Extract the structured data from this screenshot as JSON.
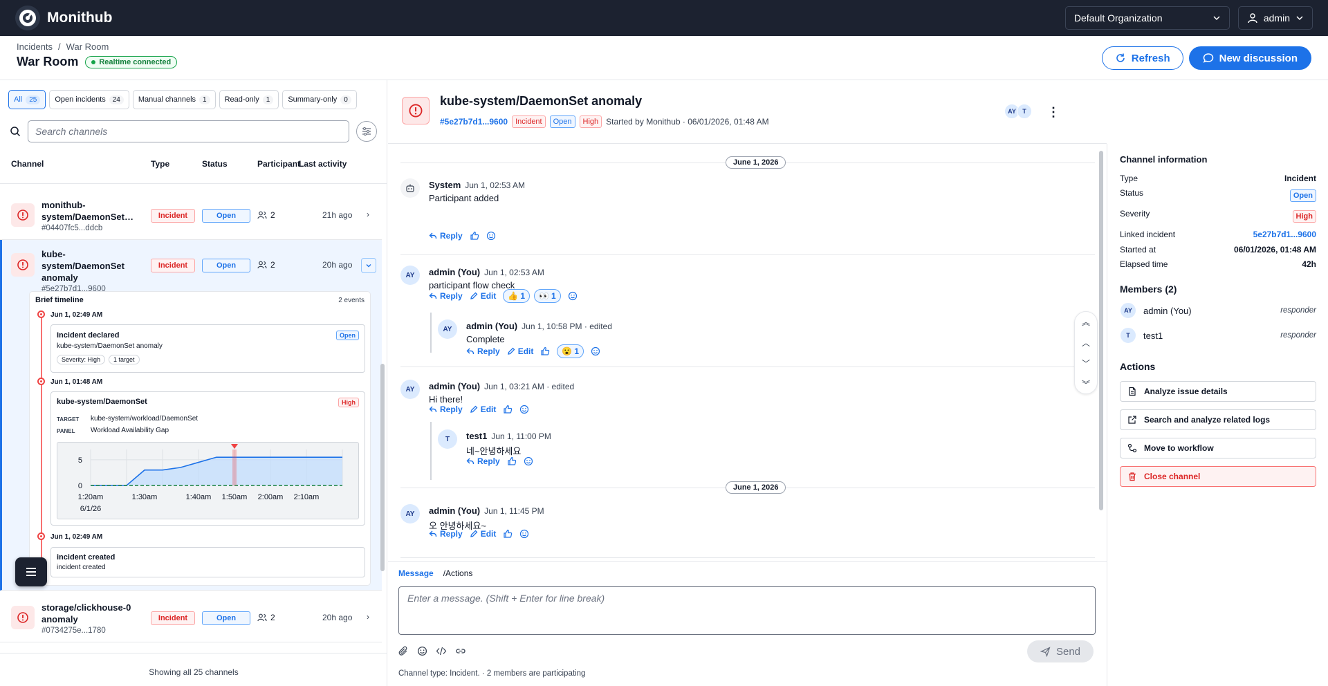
{
  "app": {
    "name": "Monithub"
  },
  "topbar": {
    "organization": "Default Organization",
    "user": "admin"
  },
  "breadcrumb": [
    "Incidents",
    "/",
    "War Room"
  ],
  "page": {
    "title": "War Room",
    "realtime": "Realtime connected",
    "refresh": "Refresh",
    "new_discussion": "New discussion"
  },
  "filters": [
    {
      "label": "All",
      "count": "25"
    },
    {
      "label": "Open incidents",
      "count": "24"
    },
    {
      "label": "Manual channels",
      "count": "1"
    },
    {
      "label": "Read-only",
      "count": "1"
    },
    {
      "label": "Summary-only",
      "count": "0"
    }
  ],
  "search": {
    "placeholder": "Search channels"
  },
  "columns": {
    "channel": "Channel",
    "type": "Type",
    "status": "Status",
    "participants": "Participants",
    "last_activity": "Last activity"
  },
  "channels": [
    {
      "name": "monithub-system/DaemonSet…",
      "id": "#04407fc5...ddcb",
      "type": "Incident",
      "status": "Open",
      "participants": "2",
      "last": "21h ago"
    },
    {
      "name": "kube-system/DaemonSet anomaly",
      "id": "#5e27b7d1...9600",
      "type": "Incident",
      "status": "Open",
      "participants": "2",
      "last": "20h ago"
    },
    {
      "name": "storage/clickhouse-0 anomaly",
      "id": "#0734275e...1780",
      "type": "Incident",
      "status": "Open",
      "participants": "2",
      "last": "20h ago"
    }
  ],
  "timeline": {
    "title": "Brief timeline",
    "events_count": "2 events",
    "events": [
      {
        "time": "Jun 1, 02:49 AM",
        "title": "Incident declared",
        "desc": "kube-system/DaemonSet anomaly",
        "badge": "Open",
        "tags": [
          "Severity: High",
          "1 target"
        ]
      },
      {
        "time": "Jun 1, 01:48 AM",
        "title": "kube-system/DaemonSet",
        "badge": "High",
        "target_label": "TARGET",
        "target": "kube-system/workload/DaemonSet",
        "panel_label": "PANEL",
        "panel": "Workload Availability Gap"
      },
      {
        "time": "Jun 1, 02:49 AM",
        "title": "incident created",
        "desc": "incident created"
      }
    ]
  },
  "chart_data": {
    "type": "area",
    "x": [
      "1:20am",
      "1:25am",
      "1:28am",
      "1:30am",
      "1:32am",
      "1:35am",
      "1:40am",
      "1:45am",
      "1:50am",
      "1:55am",
      "2:00am",
      "2:05am",
      "2:10am",
      "2:15am",
      "2:20am"
    ],
    "series": [
      {
        "values": [
          0,
          0,
          0,
          3,
          3,
          3.5,
          4.5,
          5.5,
          5.5,
          5.5,
          5.5,
          5.5,
          5.5,
          5.5,
          5.5
        ]
      }
    ],
    "baseline": 0,
    "xticks": [
      "1:20am",
      "1:30am",
      "1:40am",
      "1:50am",
      "2:00am",
      "2:10am"
    ],
    "date_label": "6/1/26",
    "yticks": [
      "0",
      "5"
    ],
    "ylim": [
      0,
      7
    ],
    "marker_x": "1:50am",
    "colors": {
      "line": "#1d72e8",
      "fill": "#bfdbfe",
      "baseline": "#15803d",
      "marker": "#ef4444"
    }
  },
  "left_footer": {
    "showing": "Showing all 25 channels"
  },
  "channel": {
    "title": "kube-system/DaemonSet anomaly",
    "id": "#5e27b7d1...9600",
    "type": "Incident",
    "status": "Open",
    "severity": "High",
    "started_by": "Started by Monithub · 06/01/2026, 01:48 AM",
    "avatars": [
      "AY",
      "T"
    ]
  },
  "messages": {
    "date1": "June 1, 2026",
    "date2": "June 1, 2026",
    "reply": "Reply",
    "edit": "Edit",
    "m1": {
      "author": "System",
      "time": "Jun 1, 02:53 AM",
      "text": "Participant added"
    },
    "m2": {
      "avatar": "AY",
      "author": "admin (You)",
      "time": "Jun 1, 02:53 AM",
      "text": "participant flow check",
      "reactions": [
        {
          "emoji": "👍",
          "count": "1"
        },
        {
          "emoji": "👀",
          "count": "1"
        }
      ]
    },
    "m2r": {
      "avatar": "AY",
      "author": "admin (You)",
      "time": "Jun 1, 10:58 PM · edited",
      "text": "Complete",
      "reactions": [
        {
          "emoji": "😮",
          "count": "1"
        }
      ]
    },
    "m3": {
      "avatar": "AY",
      "author": "admin (You)",
      "time": "Jun 1, 03:21 AM · edited",
      "text": "Hi there!"
    },
    "m3r": {
      "avatar": "T",
      "author": "test1",
      "time": "Jun 1, 11:00 PM",
      "text": "네~안녕하세요"
    },
    "m4": {
      "avatar": "AY",
      "author": "admin (You)",
      "time": "Jun 1, 11:45 PM",
      "text": "오 안녕하세요~"
    }
  },
  "composer": {
    "tab_message": "Message",
    "tab_actions": "/Actions",
    "placeholder": "Enter a message. (Shift + Enter for line break)",
    "send": "Send",
    "hint": "Channel type: Incident. · 2 members are participating"
  },
  "info": {
    "title": "Channel information",
    "rows": [
      {
        "label": "Type",
        "value": "Incident"
      },
      {
        "label": "Status",
        "value": "Open"
      },
      {
        "label": "Severity",
        "value": "High"
      },
      {
        "label": "Linked incident",
        "value": "5e27b7d1...9600"
      },
      {
        "label": "Started at",
        "value": "06/01/2026, 01:48 AM"
      },
      {
        "label": "Elapsed time",
        "value": "42h"
      }
    ],
    "members_title": "Members (2)",
    "members": [
      {
        "avatar": "AY",
        "name": "admin (You)",
        "role": "responder"
      },
      {
        "avatar": "T",
        "name": "test1",
        "role": "responder"
      }
    ],
    "actions_title": "Actions",
    "actions": [
      "Analyze issue details",
      "Search and analyze related logs",
      "Move to workflow",
      "Close channel"
    ]
  }
}
